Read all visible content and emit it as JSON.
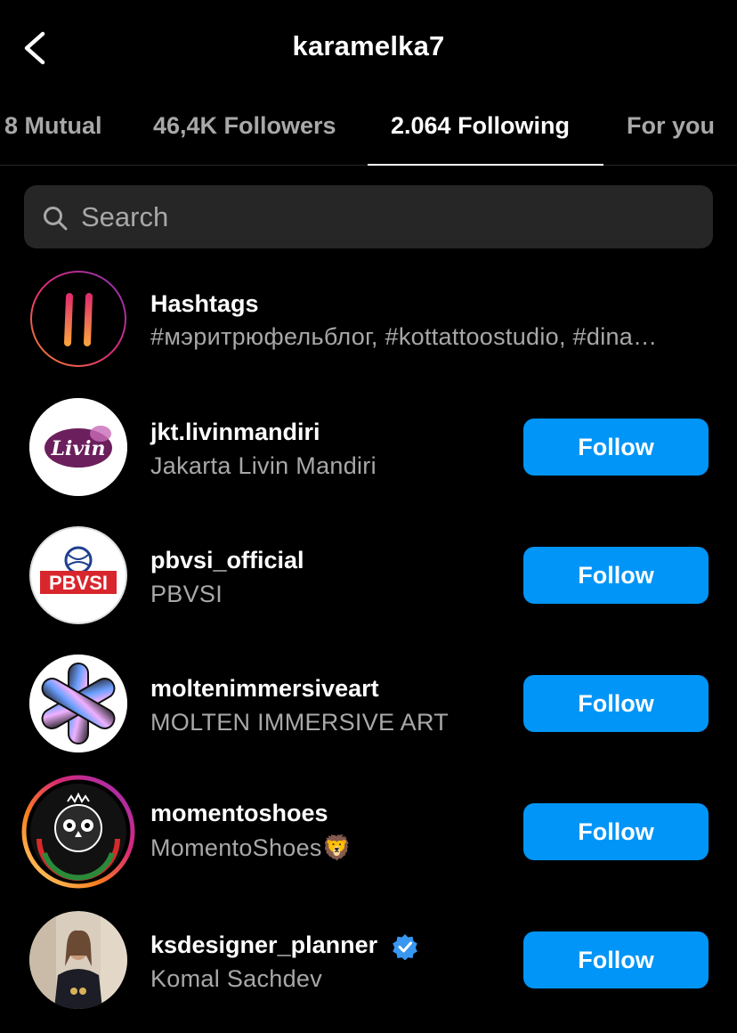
{
  "header": {
    "title": "karamelka7"
  },
  "tabs": [
    {
      "label": "8 Mutual"
    },
    {
      "label": "46,4K Followers"
    },
    {
      "label": "2.064 Following"
    },
    {
      "label": "For you"
    }
  ],
  "search": {
    "placeholder": "Search"
  },
  "hashtags": {
    "title": "Hashtags",
    "subtitle": "#мэритрюфельблог, #kottattoostudio, #dina…"
  },
  "accounts": [
    {
      "username": "jkt.livinmandiri",
      "display_name": "Jakarta Livin Mandiri",
      "button": "Follow",
      "avatar_text": "Livin"
    },
    {
      "username": "pbvsi_official",
      "display_name": "PBVSI",
      "button": "Follow",
      "avatar_text": "PBVSI"
    },
    {
      "username": "moltenimmersiveart",
      "display_name": "MOLTEN IMMERSIVE ART",
      "button": "Follow"
    },
    {
      "username": "momentoshoes",
      "display_name": "MomentoShoes🦁",
      "button": "Follow"
    },
    {
      "username": "ksdesigner_planner",
      "display_name": "Komal Sachdev",
      "button": "Follow",
      "verified": true
    }
  ],
  "colors": {
    "accent": "#0095f6",
    "background": "#000000",
    "secondary_text": "#a8a8a8"
  }
}
